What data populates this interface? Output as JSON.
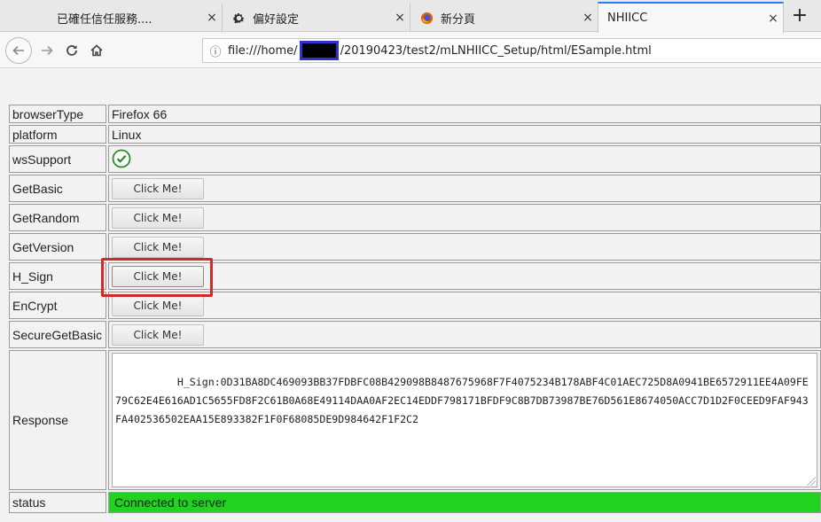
{
  "tabs": [
    {
      "label": "已確任信任服務....",
      "close": "×"
    },
    {
      "label": "偏好設定",
      "close": "×"
    },
    {
      "label": "新分頁",
      "close": "×"
    },
    {
      "label": "NHIICC",
      "close": "×"
    }
  ],
  "new_tab": "+",
  "nav": {
    "url_prefix": "file:///home/",
    "url_suffix": "/20190423/test2/mLNHIICC_Setup/html/ESample.html"
  },
  "rows": {
    "browserType": {
      "label": "browserType",
      "value": "Firefox 66"
    },
    "platform": {
      "label": "platform",
      "value": "Linux"
    },
    "wsSupport": {
      "label": "wsSupport"
    },
    "getBasic": {
      "label": "GetBasic",
      "button": "Click Me!"
    },
    "getRandom": {
      "label": "GetRandom",
      "button": "Click Me!"
    },
    "getVersion": {
      "label": "GetVersion",
      "button": "Click Me!"
    },
    "hSign": {
      "label": "H_Sign",
      "button": "Click Me!"
    },
    "enCrypt": {
      "label": "EnCrypt",
      "button": "Click Me!"
    },
    "secureGetBasic": {
      "label": "SecureGetBasic",
      "button": "Click Me!"
    },
    "response": {
      "label": "Response",
      "value": "H_Sign:0D31BA8DC469093BB37FDBFC08B429098B8487675968F7F4075234B178ABF4C01AEC725D8A0941BE6572911EE4A09FE79C62E4E616AD1C5655FD8F2C61B0A68E49114DAA0AF2EC14EDDF798171BFDF9C8B7DB73987BE76D561E8674050ACC7D1D2F0CEED9FAF943FA402536502EAA15E893382F1F0F68085DE9D984642F1F2C2"
    },
    "status": {
      "label": "status",
      "value": "Connected to server"
    }
  },
  "colors": {
    "status_bg": "#20d320",
    "highlight": "#d02a2a",
    "check": "#2a8a2a"
  }
}
